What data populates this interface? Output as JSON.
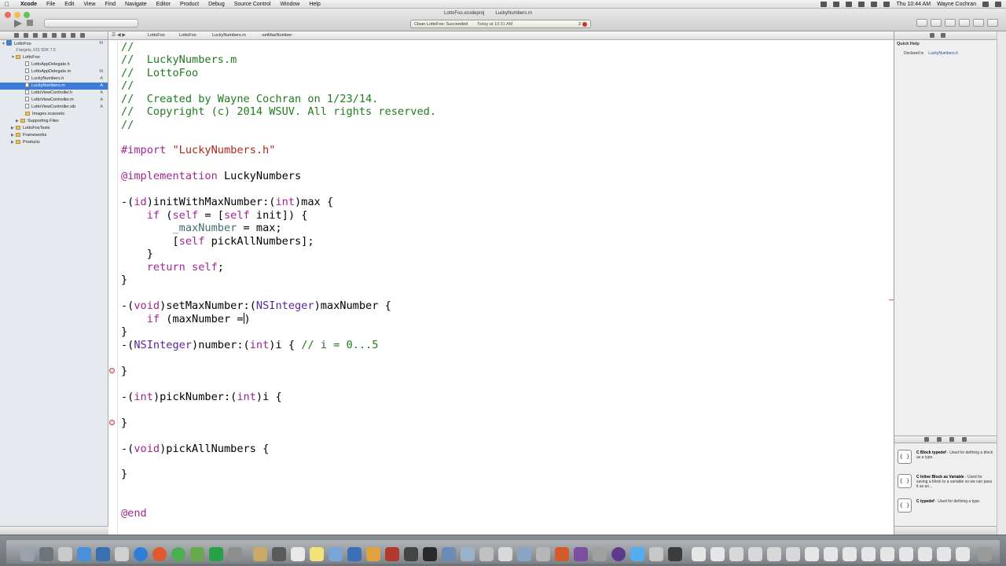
{
  "menubar": {
    "app": "Xcode",
    "menus": [
      "File",
      "Edit",
      "View",
      "Find",
      "Navigate",
      "Editor",
      "Product",
      "Debug",
      "Source Control",
      "Window",
      "Help"
    ],
    "clock": "Thu 10:44 AM",
    "user": "Wayne Cochran"
  },
  "toolbar": {
    "activity_status": "Clean LottoFoo: Succeeded",
    "activity_time": "Today at 10:31 AM",
    "error_count": "2",
    "doc_tabs": [
      "LottoFoo.xcodeproj",
      "LuckyNumbers.m"
    ]
  },
  "navigator": {
    "project": "LottoFoo",
    "project_sub": "2 targets, iOS SDK 7.0",
    "project_status": "M",
    "group": "LottoFoo",
    "files": [
      {
        "name": "LottoAppDelegate.h",
        "status": ""
      },
      {
        "name": "LottoAppDelegate.m",
        "status": "M"
      },
      {
        "name": "LuckyNumbers.h",
        "status": "A"
      },
      {
        "name": "LuckyNumbers.m",
        "status": "A"
      },
      {
        "name": "LottoViewController.h",
        "status": "A"
      },
      {
        "name": "LottoViewController.m",
        "status": "A"
      },
      {
        "name": "LottoViewController.xib",
        "status": "A"
      },
      {
        "name": "Images.xcassets",
        "status": ""
      }
    ],
    "folders": [
      "Supporting Files",
      "LottoFooTests",
      "Frameworks",
      "Products"
    ]
  },
  "jumpbar": {
    "crumbs": [
      "LottoFoo",
      "LottoFoo",
      "LuckyNumbers.m",
      "-setMaxNumber:"
    ]
  },
  "editor": {
    "lines": {
      "l1": "//",
      "l2": "//  LuckyNumbers.m",
      "l3": "//  LottoFoo",
      "l4": "//",
      "l5": "//  Created by Wayne Cochran on 1/23/14.",
      "l6": "//  Copyright (c) 2014 WSUV. All rights reserved.",
      "l7": "//",
      "import_kw": "#import",
      "import_str": "\"LuckyNumbers.h\"",
      "impl_kw": "@implementation",
      "impl_name": " LuckyNumbers",
      "init_a": "-(",
      "init_b": "id",
      "init_c": ")initWithMaxNumber:(",
      "init_d": "int",
      "init_e": ")max {",
      "if1_a": "    ",
      "if1_b": "if",
      "if1_c": " (",
      "if1_d": "self",
      "if1_e": " = [",
      "if1_f": "self",
      "if1_g": " init]) {",
      "assign_a": "        ",
      "assign_b": "_maxNumber",
      "assign_c": " = max;",
      "pick_a": "        [",
      "pick_b": "self",
      "pick_c": " pickAllNumbers];",
      "close_if": "    }",
      "ret_a": "    ",
      "ret_b": "return",
      "ret_c": " ",
      "ret_d": "self",
      "ret_e": ";",
      "brace": "}",
      "set_a": "-(",
      "set_b": "void",
      "set_c": ")setMaxNumber:(",
      "set_d": "NSInteger",
      "set_e": ")maxNumber {",
      "if2_a": "    ",
      "if2_b": "if",
      "if2_c": " (maxNumber =",
      "if2_d": ")",
      "num_a": "-(",
      "num_b": "NSInteger",
      "num_c": ")number:(",
      "num_d": "int",
      "num_e": ")i { ",
      "num_f": "// i = 0...5",
      "pn_a": "-(",
      "pn_b": "int",
      "pn_c": ")pickNumber:(",
      "pn_d": "int",
      "pn_e": ")i {",
      "pa_a": "-(",
      "pa_b": "void",
      "pa_c": ")pickAllNumbers {",
      "end": "@end"
    }
  },
  "utilities": {
    "quick_help_title": "Quick Help",
    "declared_label": "Declared in",
    "declared_value": "LuckyNumbers.h",
    "snippets": [
      {
        "icon": "{ }",
        "title": "C Block typedef",
        "desc": " - Used for defining a block as a type."
      },
      {
        "icon": "{ }",
        "title": "C Inline Block as Variable",
        "desc": " - Used for saving a block to a variable so we can pass it as an..."
      },
      {
        "icon": "{ }",
        "title": "C typedef",
        "desc": " - Used for defining a type."
      }
    ]
  }
}
